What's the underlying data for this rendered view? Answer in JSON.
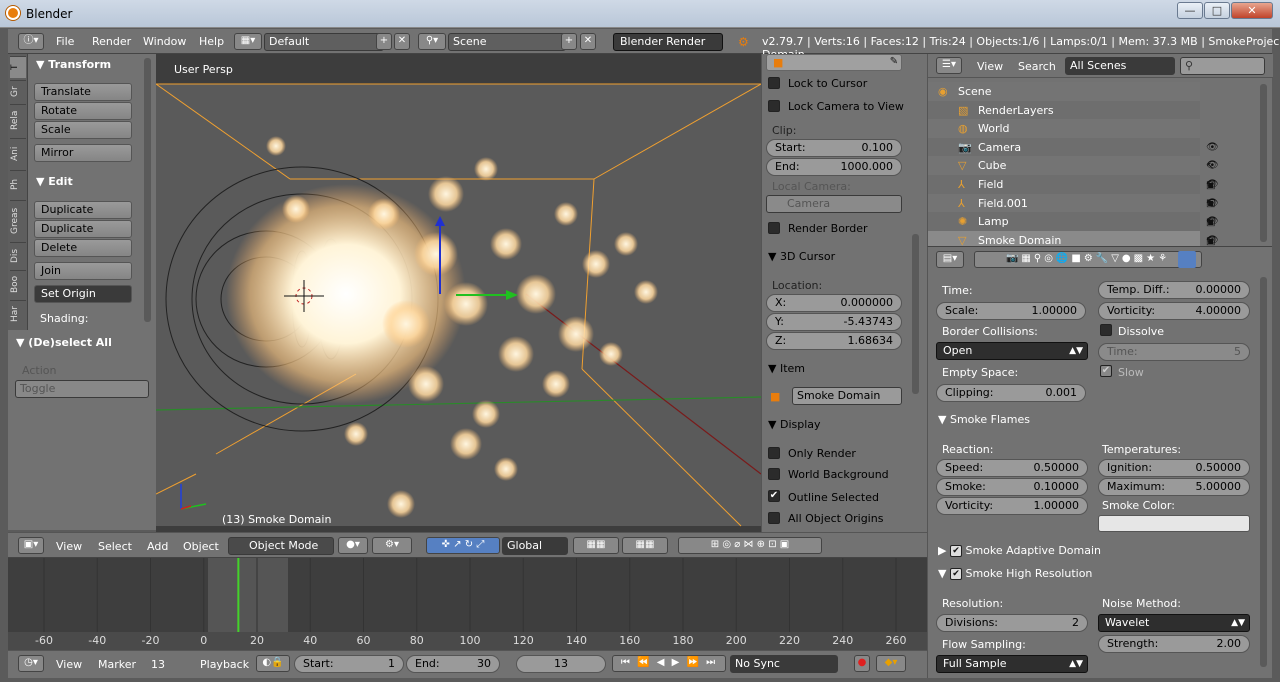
{
  "window": {
    "title": "Blender",
    "min": "—",
    "max": "□",
    "close": "✕"
  },
  "info": {
    "menus": [
      "File",
      "Render",
      "Window",
      "Help"
    ],
    "layout": "Default",
    "scene": "Scene",
    "engine": "Blender Render",
    "stats": "v2.79.7 | Verts:16 | Faces:12 | Tris:24 | Objects:1/6 | Lamps:0/1 | Mem: 37.3 MB | Smoke Domain",
    "proj": "Projec"
  },
  "tool_tabs": [
    "T",
    "Gr",
    "Rela",
    "Ani",
    "Ph",
    "Greas",
    "Dis",
    "Boo",
    "Har"
  ],
  "toolshelf": {
    "transform": "Transform",
    "translate": "Translate",
    "rotate": "Rotate",
    "scale": "Scale",
    "mirror": "Mirror",
    "edit": "Edit",
    "duplicate": "Duplicate",
    "duplicate_linked": "Duplicate Linked",
    "delete": "Delete",
    "join": "Join",
    "set_origin": "Set Origin",
    "shading": "Shading:"
  },
  "operator": {
    "title": "(De)select All",
    "action_label": "Action",
    "action_value": "Toggle"
  },
  "viewport": {
    "persp": "User Persp",
    "object_label": "(13) Smoke Domain"
  },
  "npanel": {
    "lock_cursor": "Lock to Cursor",
    "lock_camera": "Lock Camera to View",
    "clip": "Clip:",
    "start_label": "Start:",
    "start": "0.100",
    "end_label": "End:",
    "end": "1000.000",
    "local_camera": "Local Camera:",
    "camera": "Camera",
    "render_border": "Render Border",
    "cursor3d": "3D Cursor",
    "location": "Location:",
    "x_label": "X:",
    "x": "0.000000",
    "y_label": "Y:",
    "y": "-5.43743",
    "z_label": "Z:",
    "z": "1.68634",
    "item": "Item",
    "item_name": "Smoke Domain",
    "display": "Display",
    "only_render": "Only Render",
    "world_bg": "World Background",
    "outline_sel": "Outline Selected",
    "all_origins": "All Object Origins"
  },
  "view3d_header": {
    "view": "View",
    "select": "Select",
    "add": "Add",
    "object": "Object",
    "mode": "Object Mode",
    "orientation": "Global"
  },
  "timeline": {
    "ticks": [
      "-60",
      "-40",
      "-20",
      "0",
      "20",
      "40",
      "60",
      "80",
      "100",
      "120",
      "140",
      "160",
      "180",
      "200",
      "220",
      "240",
      "260"
    ],
    "current_frame": 13
  },
  "timeline_header": {
    "view": "View",
    "marker": "Marker",
    "frame": "13",
    "playback": "Playback",
    "start_label": "Start:",
    "start": "1",
    "end_label": "End:",
    "end": "30",
    "sync": "No Sync"
  },
  "outliner": {
    "view": "View",
    "search": "Search",
    "filter": "All Scenes",
    "items": [
      {
        "name": "Scene"
      },
      {
        "name": "RenderLayers"
      },
      {
        "name": "World"
      },
      {
        "name": "Camera"
      },
      {
        "name": "Cube"
      },
      {
        "name": "Field"
      },
      {
        "name": "Field.001"
      },
      {
        "name": "Lamp"
      },
      {
        "name": "Smoke Domain"
      }
    ]
  },
  "properties": {
    "time": "Time:",
    "scale_label": "Scale:",
    "scale": "1.00000",
    "temp_diff_label": "Temp. Diff.:",
    "temp_diff": "0.00000",
    "vorticity_label": "Vorticity:",
    "vorticity": "4.00000",
    "border_collisions": "Border Collisions:",
    "border_value": "Open",
    "dissolve": "Dissolve",
    "dtime_label": "Time:",
    "dtime": "5",
    "empty_space": "Empty Space:",
    "slow": "Slow",
    "clipping_label": "Clipping:",
    "clipping": "0.001",
    "smoke_flames": "Smoke Flames",
    "reaction": "Reaction:",
    "temperatures": "Temperatures:",
    "speed_label": "Speed:",
    "speed": "0.50000",
    "ignition_label": "Ignition:",
    "ignition": "0.50000",
    "smoke_label": "Smoke:",
    "smoke": "0.10000",
    "maximum_label": "Maximum:",
    "maximum": "5.00000",
    "fvort_label": "Vorticity:",
    "fvort": "1.00000",
    "smoke_color": "Smoke Color:",
    "adaptive": "Smoke Adaptive Domain",
    "highres": "Smoke High Resolution",
    "resolution": "Resolution:",
    "noise_method": "Noise Method:",
    "divisions_label": "Divisions:",
    "divisions": "2",
    "noise_value": "Wavelet",
    "flow_sampling": "Flow Sampling:",
    "strength_label": "Strength:",
    "strength": "2.00",
    "flow_value": "Full Sample"
  },
  "colors": {
    "accent": "#e87d0d",
    "selected": "#5680c2",
    "panel": "#727272",
    "timeline_cursor": "#44d22a"
  }
}
